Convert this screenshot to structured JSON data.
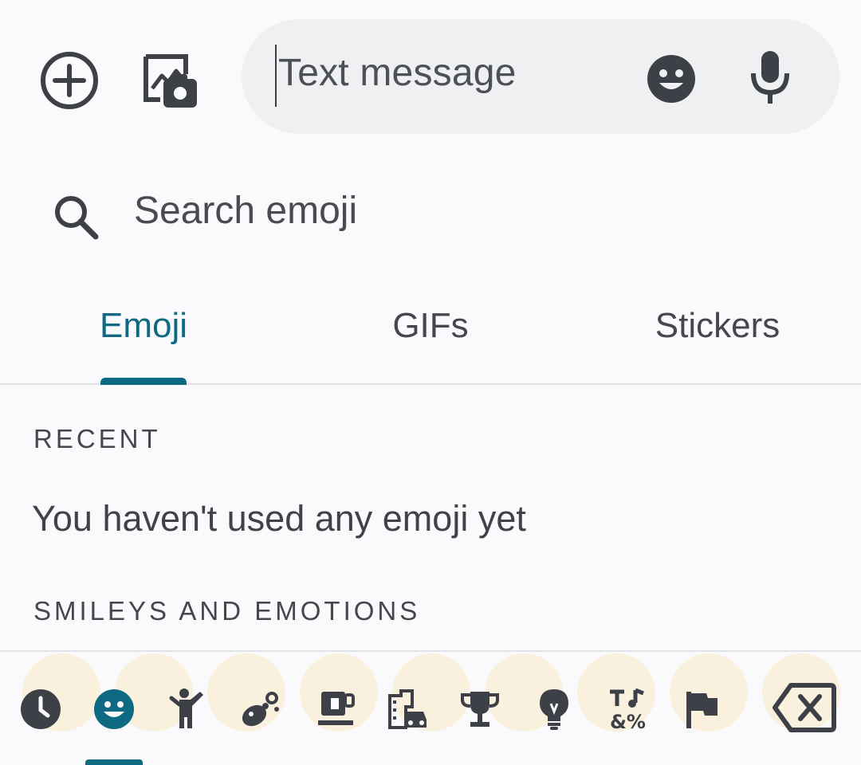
{
  "compose": {
    "message_placeholder": "Text message",
    "icons": [
      "add-circle-icon",
      "gallery-camera-icon",
      "emoji-icon",
      "mic-icon"
    ]
  },
  "search": {
    "placeholder": "Search emoji"
  },
  "tabs": [
    {
      "label": "Emoji",
      "active": true
    },
    {
      "label": "GIFs",
      "active": false
    },
    {
      "label": "Stickers",
      "active": false
    }
  ],
  "sections": {
    "recent_heading": "RECENT",
    "recent_empty": "You haven't used any emoji yet",
    "smileys_heading": "SMILEYS AND EMOTIONS"
  },
  "categories": [
    {
      "icon": "clock-icon",
      "active": false
    },
    {
      "icon": "smiley-icon",
      "active": true
    },
    {
      "icon": "person-icon",
      "active": false
    },
    {
      "icon": "animal-icon",
      "active": false
    },
    {
      "icon": "food-icon",
      "active": false
    },
    {
      "icon": "travel-icon",
      "active": false
    },
    {
      "icon": "trophy-icon",
      "active": false
    },
    {
      "icon": "lightbulb-icon",
      "active": false
    },
    {
      "icon": "symbols-icon",
      "active": false
    },
    {
      "icon": "flag-icon",
      "active": false
    },
    {
      "icon": "backspace-icon",
      "active": false
    }
  ],
  "colors": {
    "accent": "#0e6a83",
    "icon": "#3d4046",
    "field_bg": "#eff0f2",
    "background": "#fafafc"
  }
}
